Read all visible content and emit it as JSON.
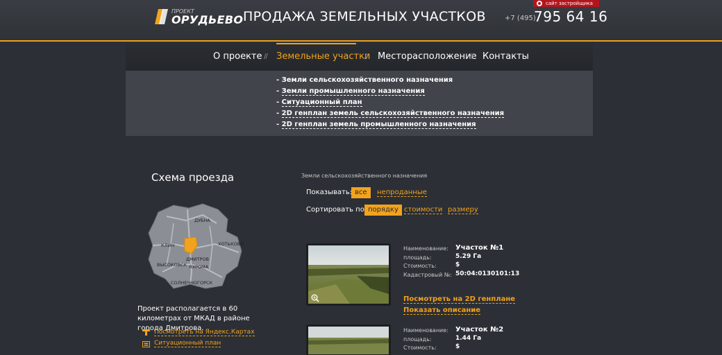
{
  "header": {
    "logo_small": "ПРОЕКТ",
    "logo_name": "ОРУДЬЕВО",
    "site_title": "ПРОДАЖА ЗЕМЕЛЬНЫХ УЧАСТКОВ",
    "phone_prefix": "+7  (495)",
    "phone_number": "795 64 16",
    "developer_badge": "сайт застройщика"
  },
  "nav": {
    "items": [
      {
        "label": "О проекте"
      },
      {
        "label": "Земельные участки"
      },
      {
        "label": "Месторасположение"
      },
      {
        "label": "Контакты"
      }
    ],
    "separator": "//"
  },
  "submenu": {
    "items": [
      {
        "label": "Земли сельскохозяйственного назначения"
      },
      {
        "label": "Земли промышленного назначения"
      },
      {
        "label": "Ситуационный план"
      },
      {
        "label": "2D генплан земель сельскохозяйственного назначения"
      },
      {
        "label": "2D генплан земель промышленного назначения"
      }
    ],
    "bullet": "- "
  },
  "sidebar": {
    "title": "Схема проезда",
    "map_labels": {
      "dubna": "ДУБНА",
      "klin": "КЛИН",
      "khotkovo": "ХОТЬКОВО",
      "dmitrov": "ДМИТРОВ",
      "vysokovsk": "ВЫСОКОВСК",
      "yakhroma": "ЯХРОМА",
      "solnechnogorsk": "СОЛНЕЧНОГОРСК"
    },
    "description": "Проект располагается в 60 километрах от МКАД в районе города Дмитрова.",
    "links": [
      {
        "label": "Посмотреть на Яндекс.Картах",
        "icon": "map-marker-icon"
      },
      {
        "label": "Ситуационный план",
        "icon": "plan-icon"
      }
    ]
  },
  "content": {
    "breadcrumb": "Земли сельскохозяйственного назначения",
    "show_label": "Показывать:",
    "show_options": [
      {
        "label": "все"
      },
      {
        "label": "непроданные"
      }
    ],
    "sort_label": "Сортировать по:",
    "sort_options": [
      {
        "label": "порядку"
      },
      {
        "label": "стоимости"
      },
      {
        "label": "размеру"
      }
    ],
    "colors": {
      "accent": "#f2a31d",
      "background": "#2c2f35",
      "submenu": "#41444a"
    }
  },
  "listings": [
    {
      "name_label": "Наименование:",
      "name": "Участок №1",
      "area_label": "площадь:",
      "area": "5.29 Га",
      "price_label": "Стоимость:",
      "price": "$",
      "cadastral_label": "Кадастровый №:",
      "cadastral": "50:04:0130101:13",
      "link_plan": "Посмотреть на 2D генплане",
      "link_desc": "Показать описание"
    },
    {
      "name_label": "Наименование:",
      "name": "Участок №2",
      "area_label": "площадь:",
      "area": "1.44 Га",
      "price_label": "Стоимость:",
      "price": "$"
    }
  ]
}
